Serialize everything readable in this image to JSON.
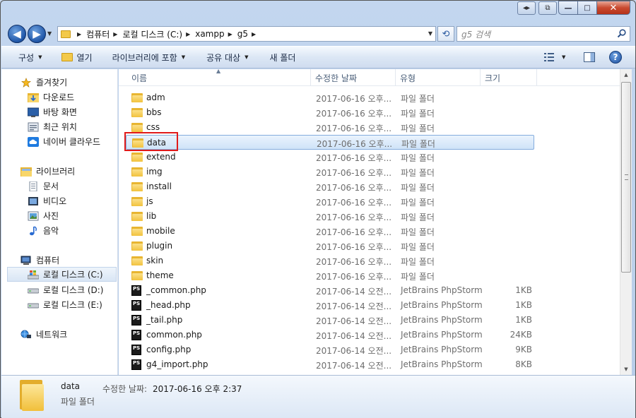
{
  "titlebar": {
    "min": "—",
    "max": "□",
    "close": "✕"
  },
  "address": {
    "crumbs": [
      "컴퓨터",
      "로컬 디스크 (C:)",
      "xampp",
      "g5"
    ]
  },
  "search": {
    "placeholder": "g5 검색"
  },
  "toolbar": {
    "organize": "구성",
    "open": "열기",
    "include_library": "라이브러리에 포함",
    "share": "공유 대상",
    "new_folder": "새 폴더"
  },
  "nav": {
    "favorites": "즐겨찾기",
    "downloads": "다운로드",
    "desktop": "바탕 화면",
    "recent": "최근 위치",
    "naver_cloud": "네이버 클라우드",
    "libraries": "라이브러리",
    "documents": "문서",
    "videos": "비디오",
    "pictures": "사진",
    "music": "음악",
    "computer": "컴퓨터",
    "drive_c": "로컬 디스크 (C:)",
    "drive_d": "로컬 디스크 (D:)",
    "drive_e": "로컬 디스크 (E:)",
    "network": "네트워크"
  },
  "columns": {
    "name": "이름",
    "date": "수정한 날짜",
    "type": "유형",
    "size": "크기"
  },
  "rows": [
    {
      "name": "adm",
      "date": "2017-06-16 오후...",
      "type": "파일 폴더",
      "size": "",
      "kind": "folder"
    },
    {
      "name": "bbs",
      "date": "2017-06-16 오후...",
      "type": "파일 폴더",
      "size": "",
      "kind": "folder"
    },
    {
      "name": "css",
      "date": "2017-06-16 오후...",
      "type": "파일 폴더",
      "size": "",
      "kind": "folder"
    },
    {
      "name": "data",
      "date": "2017-06-16 오후...",
      "type": "파일 폴더",
      "size": "",
      "kind": "folder",
      "selected": true
    },
    {
      "name": "extend",
      "date": "2017-06-16 오후...",
      "type": "파일 폴더",
      "size": "",
      "kind": "folder"
    },
    {
      "name": "img",
      "date": "2017-06-16 오후...",
      "type": "파일 폴더",
      "size": "",
      "kind": "folder"
    },
    {
      "name": "install",
      "date": "2017-06-16 오후...",
      "type": "파일 폴더",
      "size": "",
      "kind": "folder"
    },
    {
      "name": "js",
      "date": "2017-06-16 오후...",
      "type": "파일 폴더",
      "size": "",
      "kind": "folder"
    },
    {
      "name": "lib",
      "date": "2017-06-16 오후...",
      "type": "파일 폴더",
      "size": "",
      "kind": "folder"
    },
    {
      "name": "mobile",
      "date": "2017-06-16 오후...",
      "type": "파일 폴더",
      "size": "",
      "kind": "folder"
    },
    {
      "name": "plugin",
      "date": "2017-06-16 오후...",
      "type": "파일 폴더",
      "size": "",
      "kind": "folder"
    },
    {
      "name": "skin",
      "date": "2017-06-16 오후...",
      "type": "파일 폴더",
      "size": "",
      "kind": "folder"
    },
    {
      "name": "theme",
      "date": "2017-06-16 오후...",
      "type": "파일 폴더",
      "size": "",
      "kind": "folder"
    },
    {
      "name": "_common.php",
      "date": "2017-06-14 오전...",
      "type": "JetBrains PhpStorm",
      "size": "1KB",
      "kind": "php"
    },
    {
      "name": "_head.php",
      "date": "2017-06-14 오전...",
      "type": "JetBrains PhpStorm",
      "size": "1KB",
      "kind": "php"
    },
    {
      "name": "_tail.php",
      "date": "2017-06-14 오전...",
      "type": "JetBrains PhpStorm",
      "size": "1KB",
      "kind": "php"
    },
    {
      "name": "common.php",
      "date": "2017-06-14 오전...",
      "type": "JetBrains PhpStorm",
      "size": "24KB",
      "kind": "php"
    },
    {
      "name": "config.php",
      "date": "2017-06-14 오전...",
      "type": "JetBrains PhpStorm",
      "size": "9KB",
      "kind": "php"
    },
    {
      "name": "g4_import.php",
      "date": "2017-06-14 오전...",
      "type": "JetBrains PhpStorm",
      "size": "8KB",
      "kind": "php"
    }
  ],
  "details": {
    "name": "data",
    "type": "파일 폴더",
    "date_label": "수정한 날짜:",
    "date": "2017-06-16 오후 2:37"
  },
  "icons": {
    "php_badge": "PS"
  }
}
